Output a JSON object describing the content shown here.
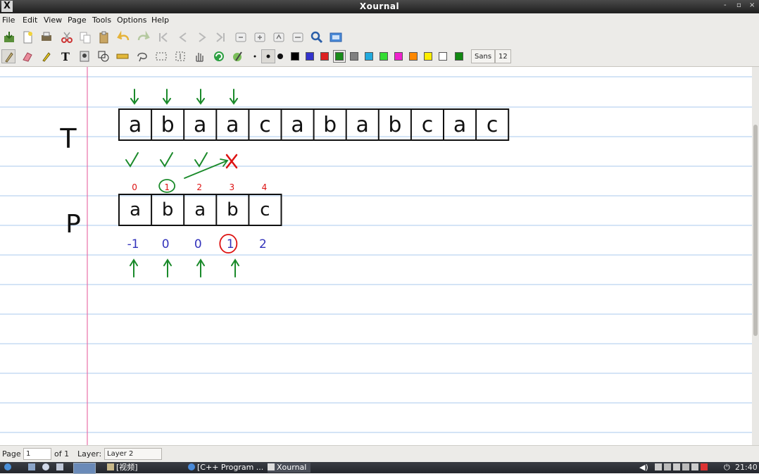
{
  "window": {
    "title": "Xournal",
    "app_icon_label": "X",
    "controls": [
      "-",
      "▫",
      "×"
    ]
  },
  "menu": [
    "File",
    "Edit",
    "View",
    "Page",
    "Tools",
    "Options",
    "Help"
  ],
  "toolbar": {
    "font_name": "Sans",
    "font_size": "12",
    "colors": [
      "#000000",
      "#3333cc",
      "#dd2222",
      "#1a8c1a",
      "#808080",
      "#22aadd",
      "#33dd33",
      "#ee22cc",
      "#ff8800",
      "#ffee00",
      "#ffffff",
      "#118811"
    ],
    "selected_color": "#1a8c1a"
  },
  "page": {
    "text_label": "T",
    "pattern_label": "P",
    "text_chars": [
      "a",
      "b",
      "a",
      "a",
      "c",
      "a",
      "b",
      "a",
      "b",
      "c",
      "a",
      "c"
    ],
    "pattern_chars": [
      "a",
      "b",
      "a",
      "b",
      "c"
    ],
    "pattern_indices": [
      "0",
      "1",
      "2",
      "3",
      "4"
    ],
    "next_values": [
      "-1",
      "0",
      "0",
      "1",
      "2"
    ],
    "marks": [
      "✓",
      "✓",
      "✓"
    ],
    "mismatch_mark": "X",
    "ink_colors": {
      "green": "#1a8a2a",
      "red": "#dd1111",
      "blue": "#3333bb",
      "black": "#111111",
      "rule": "#a8c8ec",
      "margin": "#e870a8"
    }
  },
  "statusbar": {
    "page_label": "Page",
    "page_value": "1",
    "of_label": "of 1",
    "layer_label": "Layer:",
    "layer_value": "Layer 2"
  },
  "taskbar": {
    "folder_item": "[视频]",
    "browser_item": "[C++ Program ...",
    "xournal_item": "Xournal",
    "clock": "21:40"
  }
}
